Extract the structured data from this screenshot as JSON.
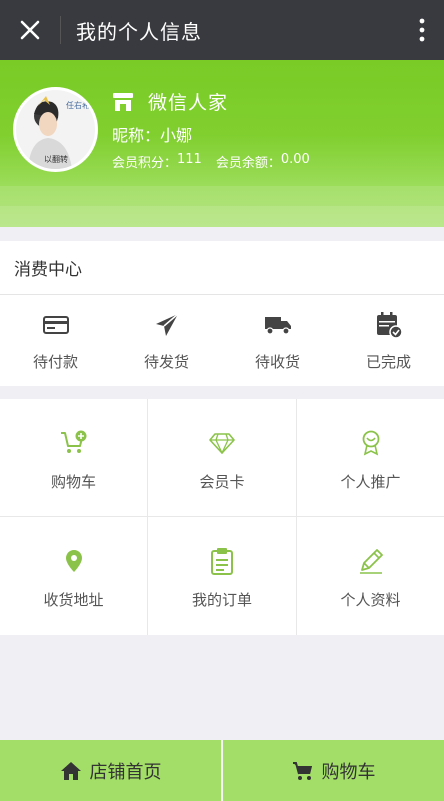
{
  "titlebar": {
    "title": "我的个人信息",
    "close_icon": "close-icon",
    "more_icon": "more-vertical-icon"
  },
  "profile": {
    "shop_icon": "store-icon",
    "shop_name": "微信人家",
    "nickname_label": "昵称：",
    "nickname": "小娜",
    "points_label": "会员积分：",
    "points": "111",
    "balance_label": "会员余额：",
    "balance": "0.00",
    "avatar_text_top": "任右希",
    "avatar_text_bottom": "以翻转"
  },
  "consumption_center": {
    "title": "消费中心",
    "orders": [
      {
        "label": "待付款",
        "icon": "card-icon"
      },
      {
        "label": "待发货",
        "icon": "paper-plane-icon"
      },
      {
        "label": "待收货",
        "icon": "truck-icon"
      },
      {
        "label": "已完成",
        "icon": "calendar-check-icon"
      }
    ]
  },
  "grid": [
    {
      "label": "购物车",
      "icon": "cart-add-icon"
    },
    {
      "label": "会员卡",
      "icon": "diamond-icon"
    },
    {
      "label": "个人推广",
      "icon": "award-icon"
    },
    {
      "label": "收货地址",
      "icon": "location-pin-icon"
    },
    {
      "label": "我的订单",
      "icon": "clipboard-icon"
    },
    {
      "label": "个人资料",
      "icon": "pencil-icon"
    }
  ],
  "bottombar": {
    "home_label": "店铺首页",
    "cart_label": "购物车",
    "home_icon": "home-icon",
    "cart_icon": "cart-icon"
  },
  "colors": {
    "titlebar": "#393a3f",
    "header_green": "#7acb26",
    "icon_green": "#8bc34a",
    "bottom_green": "#a3df68"
  }
}
